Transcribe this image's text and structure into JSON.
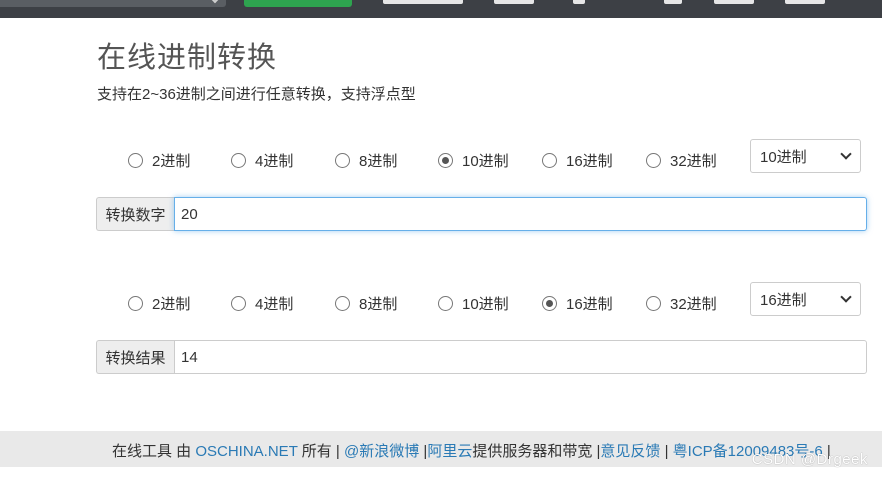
{
  "header": {
    "title": "在线进制转换",
    "subtitle": "支持在2~36进制之间进行任意转换，支持浮点型"
  },
  "input_section": {
    "radio_options": [
      {
        "label": "2进制",
        "checked": false
      },
      {
        "label": "4进制",
        "checked": false
      },
      {
        "label": "8进制",
        "checked": false
      },
      {
        "label": "10进制",
        "checked": true
      },
      {
        "label": "16进制",
        "checked": false
      },
      {
        "label": "32进制",
        "checked": false
      }
    ],
    "select_value": "10进制",
    "field_label": "转换数字",
    "field_value": "20"
  },
  "output_section": {
    "radio_options": [
      {
        "label": "2进制",
        "checked": false
      },
      {
        "label": "4进制",
        "checked": false
      },
      {
        "label": "8进制",
        "checked": false
      },
      {
        "label": "10进制",
        "checked": false
      },
      {
        "label": "16进制",
        "checked": true
      },
      {
        "label": "32进制",
        "checked": false
      }
    ],
    "select_value": "16进制",
    "field_label": "转换结果",
    "field_value": "14"
  },
  "footer": {
    "prefix": "在线工具 由 ",
    "oschina_link": "OSCHINA.NET",
    "owned": " 所有 | ",
    "weibo_link": "@新浪微博",
    "sep1": " |",
    "aliyun_link": "阿里云",
    "hosting": "提供服务器和带宽 |",
    "feedback_link": "意见反馈",
    "sep2": " | ",
    "icp_link": "粤ICP备12009483号-6",
    "sep3": " |"
  },
  "watermark": "CSDN @Drgeek",
  "colors": {
    "nav_bg": "#3d4045",
    "accent_green": "#2ea44f",
    "link_blue": "#2a7ab5",
    "focus_blue": "#66afe9"
  }
}
